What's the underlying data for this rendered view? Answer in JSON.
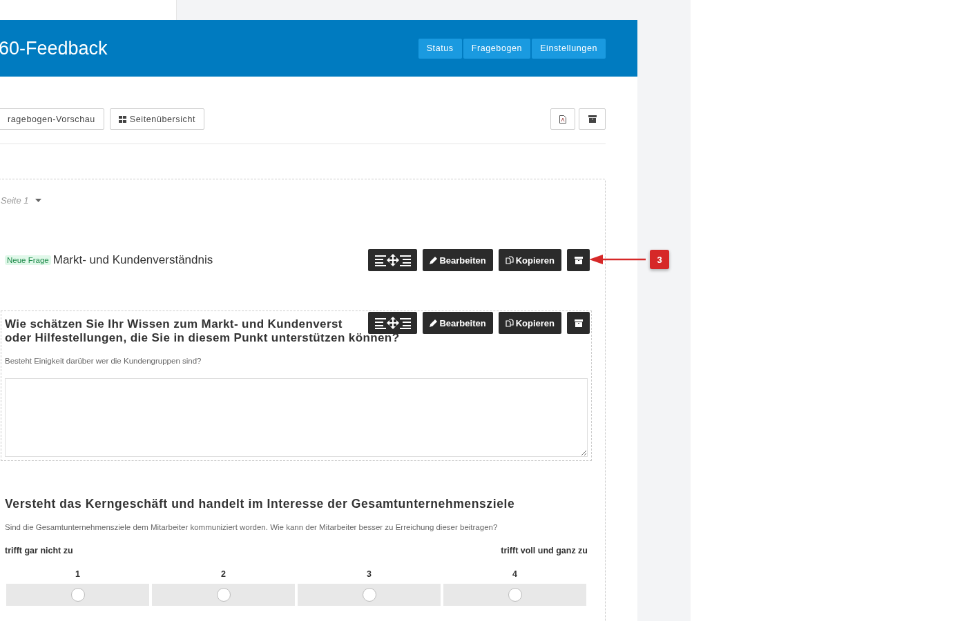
{
  "header": {
    "title": "60-Feedback",
    "nav": [
      {
        "label": "Status"
      },
      {
        "label": "Fragebogen"
      },
      {
        "label": "Einstellungen"
      }
    ]
  },
  "toolbar": {
    "buttons": [
      {
        "label": "ragebogen-Vorschau",
        "kind": "plain"
      },
      {
        "label": "Seitenübersicht",
        "kind": "grid"
      }
    ]
  },
  "page": {
    "label": "Seite 1"
  },
  "questions": [
    {
      "kind": "heading",
      "badge": "Neue Frage",
      "title": "Markt- und Kundenverständnis",
      "actions": [
        "Bearbeiten",
        "Kopieren"
      ]
    },
    {
      "kind": "text",
      "title_lines": [
        "Wie schätzen Sie Ihr Wissen zum Markt- und Kundenverst",
        "oder Hilfestellungen, die Sie in diesem Punkt unterstützen können?"
      ],
      "description": "Besteht Einigkeit darüber wer die Kundengruppen sind?",
      "actions": [
        "Bearbeiten",
        "Kopieren"
      ]
    },
    {
      "kind": "scale",
      "title": "Versteht das Kerngeschäft und handelt im Interesse der Gesamtunternehmensziele",
      "description": "Sind die Gesamtunternehmensziele dem Mitarbeiter kommuniziert worden. Wie kann der Mitarbeiter besser zu Erreichung dieser beitragen?",
      "low_label": "trifft gar nicht zu",
      "high_label": "trifft voll und ganz zu",
      "options": [
        {
          "label": "1",
          "selected": false
        },
        {
          "label": "2",
          "selected": false
        },
        {
          "label": "3",
          "selected": false
        },
        {
          "label": "4",
          "selected": false
        }
      ]
    }
  ],
  "callout": {
    "number": "3"
  }
}
